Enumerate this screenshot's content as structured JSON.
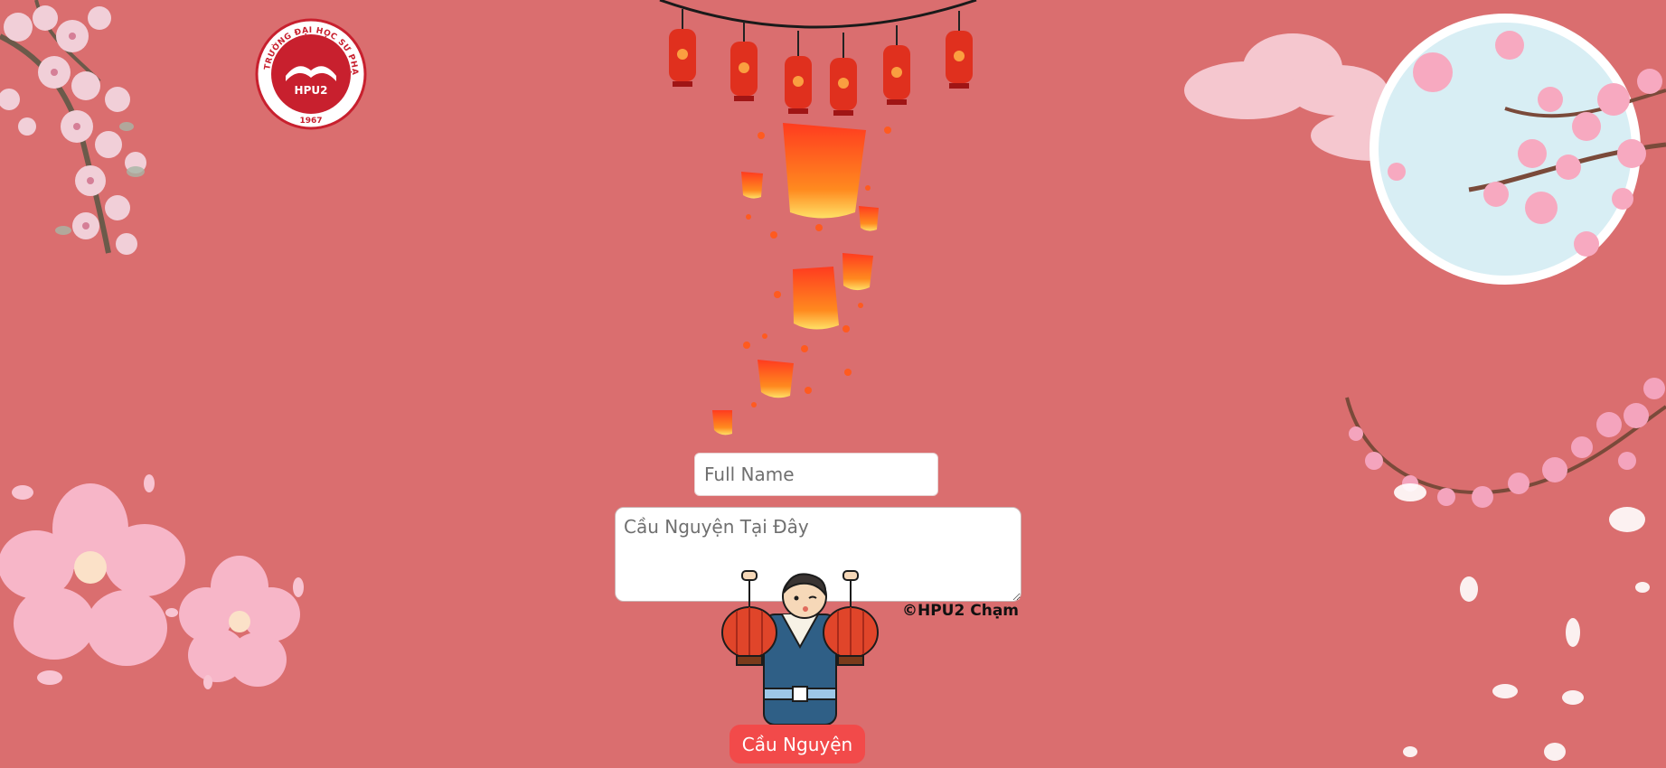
{
  "logo": {
    "ring_text": "TRƯỜNG ĐẠI HỌC SƯ PHẠM HÀ NỘI 2",
    "center_text": "HPU2",
    "year": "1967"
  },
  "form": {
    "name_placeholder": "Full Name",
    "wish_placeholder": "Cầu Nguyện Tại Đây",
    "submit_label": "Cầu Nguyện"
  },
  "credit": "©HPU2 Chạm",
  "colors": {
    "background": "#da6e6f",
    "button": "#f24a4a",
    "lantern": "#e0301e",
    "blossom": "#f7b6c8",
    "moon": "#d8eef4"
  },
  "decor": {
    "icons": [
      "cherry-blossom-branch-icon",
      "hanging-lantern-icon",
      "sky-lantern-icon",
      "moon-icon",
      "cloud-icon",
      "blossom-flower-icon",
      "petal-icon",
      "lantern-boy-illustration"
    ]
  }
}
